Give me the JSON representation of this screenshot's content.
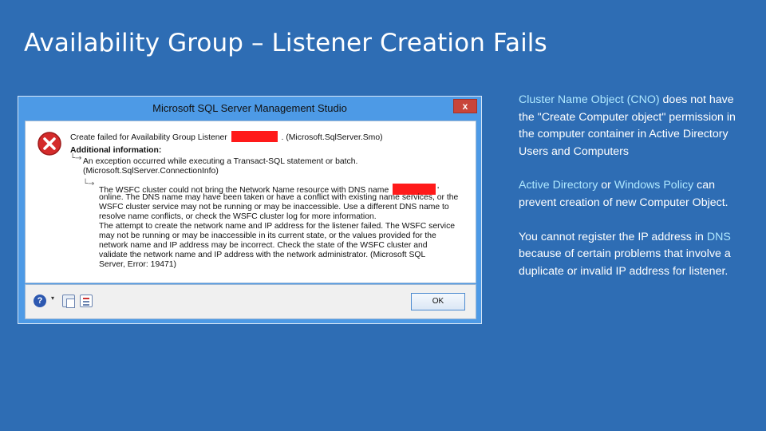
{
  "slide": {
    "title": "Availability Group – Listener Creation Fails"
  },
  "dialog": {
    "title": "Microsoft SQL Server Management Studio",
    "close_label": "x",
    "lines": {
      "l1a": "Create failed for Availability Group Listener",
      "l1b": ". (Microsoft.SqlServer.Smo)",
      "l2": "Additional information:",
      "l3": "An exception occurred while executing a Transact-SQL statement or batch.",
      "l4": "(Microsoft.SqlServer.ConnectionInfo)",
      "l5a": "The WSFC cluster could not bring the Network Name resource with DNS name",
      "l5b": "'",
      "l6": "online. The DNS name may have been taken or have a conflict with existing name services, or the",
      "l7": "WSFC cluster service may not be running or may be inaccessible. Use a different DNS name to",
      "l8": "resolve name conflicts, or check the WSFC cluster log for more information.",
      "l9": "The attempt to create the network name and IP address for the listener failed. The WSFC service",
      "l10": "may not be running or may be inaccessible in its current state, or the values provided for the",
      "l11": "network name and IP address may be incorrect. Check the state of the WSFC cluster and",
      "l12": "validate the network name and IP address with the network administrator. (Microsoft SQL",
      "l13": "Server, Error: 19471)"
    },
    "help_glyph": "?",
    "help_dropdown": "▾",
    "ok_label": "OK",
    "icons": [
      "error-icon",
      "help-icon",
      "copy-icon",
      "details-icon"
    ]
  },
  "notes": [
    {
      "parts": [
        {
          "text": "Cluster Name Object (CNO)",
          "hl": true
        },
        {
          "text": " does not have the \"Create Computer object\" permission in the computer container in Active Directory Users and Computers",
          "hl": false
        }
      ]
    },
    {
      "parts": [
        {
          "text": "Active Directory",
          "hl": true
        },
        {
          "text": " or ",
          "hl": false
        },
        {
          "text": "Windows Policy",
          "hl": true
        },
        {
          "text": " can prevent  creation of new Computer Object.",
          "hl": false
        }
      ]
    },
    {
      "parts": [
        {
          "text": "You cannot register the IP address in ",
          "hl": false
        },
        {
          "text": "DNS",
          "hl": true
        },
        {
          "text": " because of certain problems that involve a duplicate or invalid IP address for listener.",
          "hl": false
        }
      ]
    }
  ],
  "colors": {
    "background": "#2e6db4",
    "highlight": "#aee8ff",
    "dialog_frame": "#4d9ae6",
    "redaction": "#ff1a1a"
  }
}
